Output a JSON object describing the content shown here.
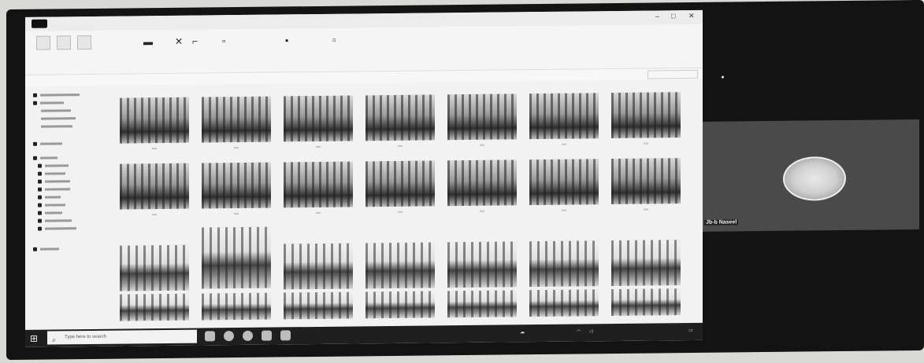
{
  "window": {
    "title": ""
  },
  "ribbon": {
    "groups": [
      "",
      "",
      "",
      "",
      ""
    ]
  },
  "address": {
    "path": "",
    "search_placeholder": ""
  },
  "nav": {
    "items": [
      "",
      "",
      "",
      "",
      "",
      "",
      "",
      "",
      "",
      "",
      "",
      "",
      "",
      "",
      "",
      "",
      ""
    ]
  },
  "thumbnails": {
    "count": 28
  },
  "status": {
    "text": ""
  },
  "taskbar": {
    "search_placeholder": "Type here to search",
    "tray_text": ""
  },
  "meeting": {
    "participant_name": "Jb-b Naseel"
  },
  "colors": {
    "screen_bg": "#f2f2f2",
    "taskbar": "#1f1f1f",
    "bezel": "#131313",
    "cam_panel": "#4a4a4a"
  },
  "icons": {
    "start": "windows-logo-icon",
    "search": "search-icon",
    "close": "close-icon"
  }
}
